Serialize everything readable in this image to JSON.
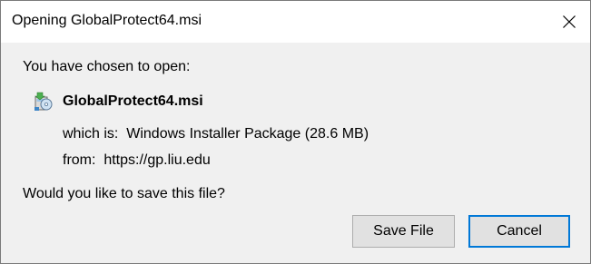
{
  "window": {
    "title": "Opening GlobalProtect64.msi",
    "close_icon": "close-icon"
  },
  "content": {
    "prompt": "You have chosen to open:",
    "file": {
      "icon": "windows-installer-icon",
      "name": "GlobalProtect64.msi"
    },
    "which_is": "which is:  Windows Installer Package (28.6 MB)",
    "from": "from:  https://gp.liu.edu",
    "question": "Would you like to save this file?"
  },
  "buttons": {
    "save_label": "Save File",
    "cancel_label": "Cancel"
  },
  "colors": {
    "accent": "#0078d7",
    "titlebar_bg": "#ffffff",
    "dialog_bg": "#f0f0f0",
    "button_bg": "#e1e1e1"
  }
}
